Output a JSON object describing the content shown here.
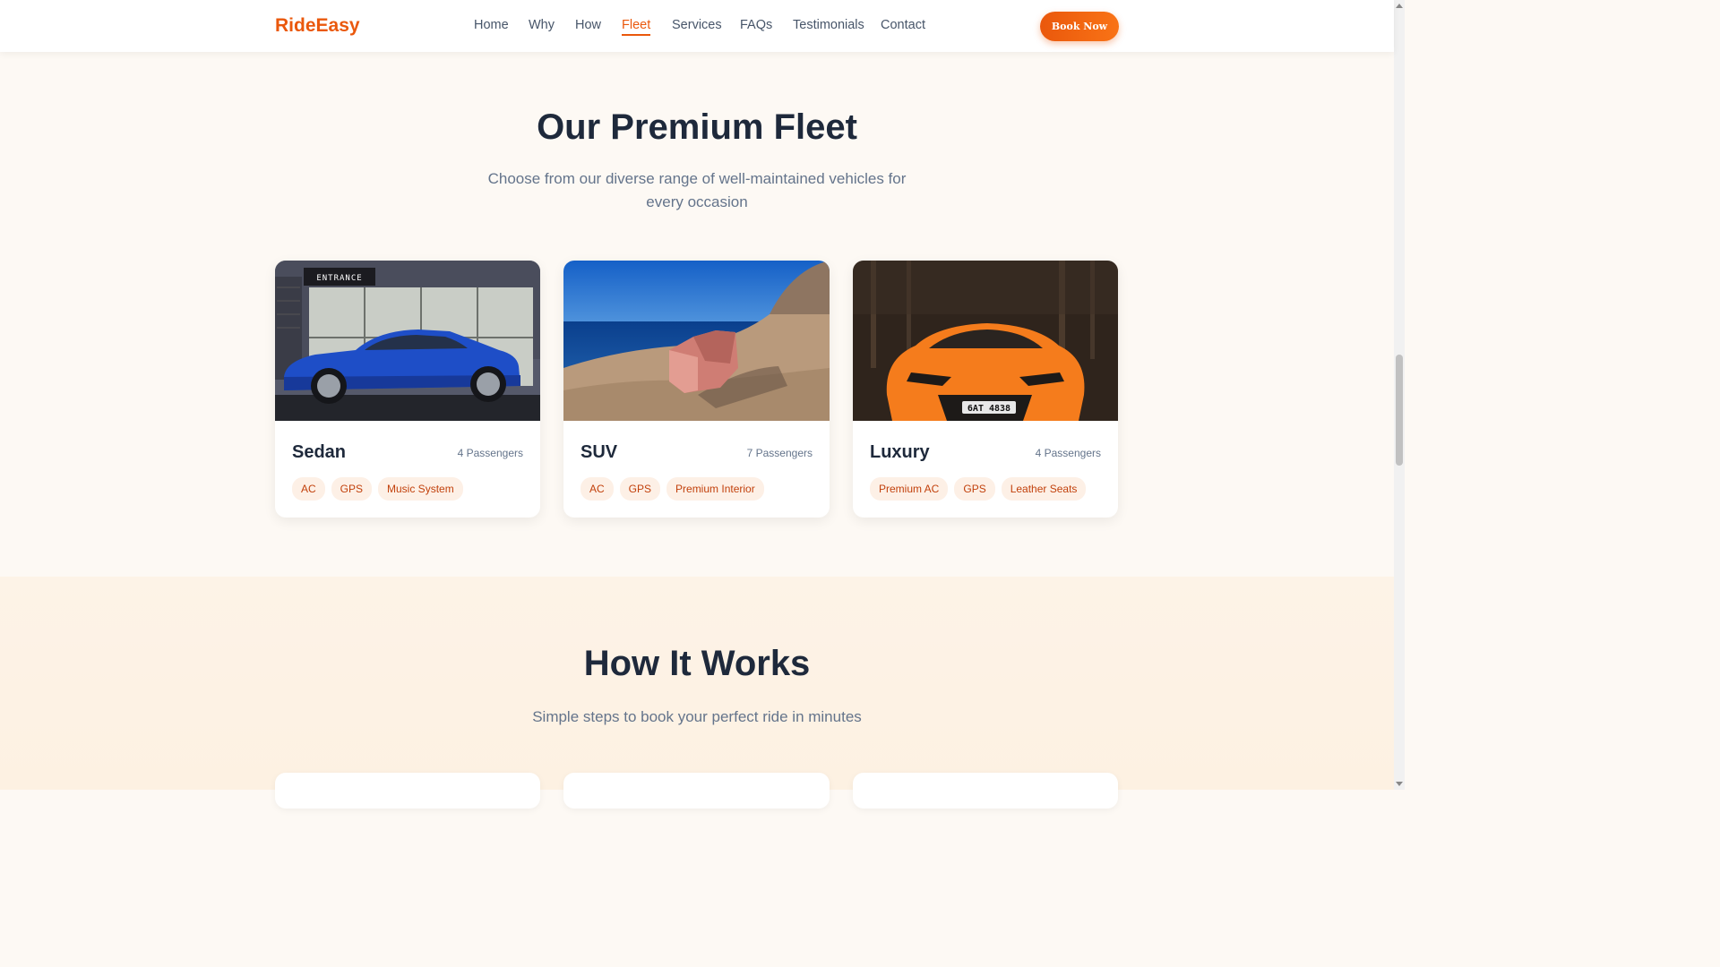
{
  "nav": {
    "brand": "RideEasy",
    "links": [
      "Home",
      "Why",
      "How",
      "Fleet",
      "Services",
      "FAQs",
      "Testimonials",
      "Contact"
    ],
    "active": "Fleet",
    "cta": "Book Now"
  },
  "fleet": {
    "title": "Our Premium Fleet",
    "subtitle": "Choose from our diverse range of well-maintained vehicles for every occasion",
    "cards": [
      {
        "name": "Sedan",
        "passengers": "4 Passengers",
        "image": "blue-sedan-photo",
        "tags": [
          "AC",
          "GPS",
          "Music System"
        ]
      },
      {
        "name": "SUV",
        "passengers": "7 Passengers",
        "image": "armchair-by-sea-photo",
        "tags": [
          "AC",
          "GPS",
          "Premium Interior"
        ]
      },
      {
        "name": "Luxury",
        "passengers": "4 Passengers",
        "image": "orange-sports-car-photo",
        "tags": [
          "Premium AC",
          "GPS",
          "Leather Seats"
        ]
      }
    ]
  },
  "how": {
    "title": "How It Works",
    "subtitle": "Simple steps to book your perfect ride in minutes"
  },
  "image_text": {
    "sign": "ENTRANCE",
    "plate": "6AT 4838"
  },
  "colors": {
    "accent": "#ea580c",
    "tag_bg": "#fdf0e6",
    "tag_text": "#c2410c"
  }
}
